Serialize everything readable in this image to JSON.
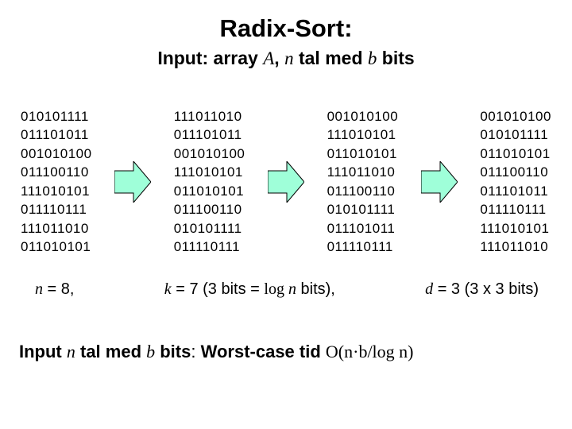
{
  "title": "Radix-Sort:",
  "subtitle": {
    "pre": "Input: array ",
    "A": "A",
    "mid1": ", ",
    "n": "n",
    "mid2": " tal med ",
    "b": "b",
    "post": " bits"
  },
  "columns": [
    [
      "010101111",
      "011101011",
      "001010100",
      "011100110",
      "111010101",
      "011110111",
      "111011010",
      "011010101"
    ],
    [
      "111011010",
      "011101011",
      "001010100",
      "111010101",
      "011010101",
      "011100110",
      "010101111",
      "011110111"
    ],
    [
      "001010100",
      "111010101",
      "011010101",
      "111011010",
      "011100110",
      "010101111",
      "011101011",
      "011110111"
    ],
    [
      "001010100",
      "010101111",
      "011010101",
      "011100110",
      "011101011",
      "011110111",
      "111010101",
      "111011010"
    ]
  ],
  "params": {
    "n": {
      "var": "n",
      "rest": " = 8,"
    },
    "k": {
      "var": "k",
      "rest1": " = 7 (3 bits = ",
      "logn": "log ",
      "nvar": "n",
      "rest2": " bits),"
    },
    "d": {
      "var": "d",
      "rest": " = 3 (3 x 3 bits)"
    }
  },
  "bottom": {
    "pre": "Input ",
    "n": "n",
    "mid1": " tal med ",
    "b": "b",
    "mid2": " bits",
    "colon": ":  ",
    "label": "Worst-case tid ",
    "math": "O(n·b/log n)"
  },
  "arrow_fill": "#9fffd9"
}
